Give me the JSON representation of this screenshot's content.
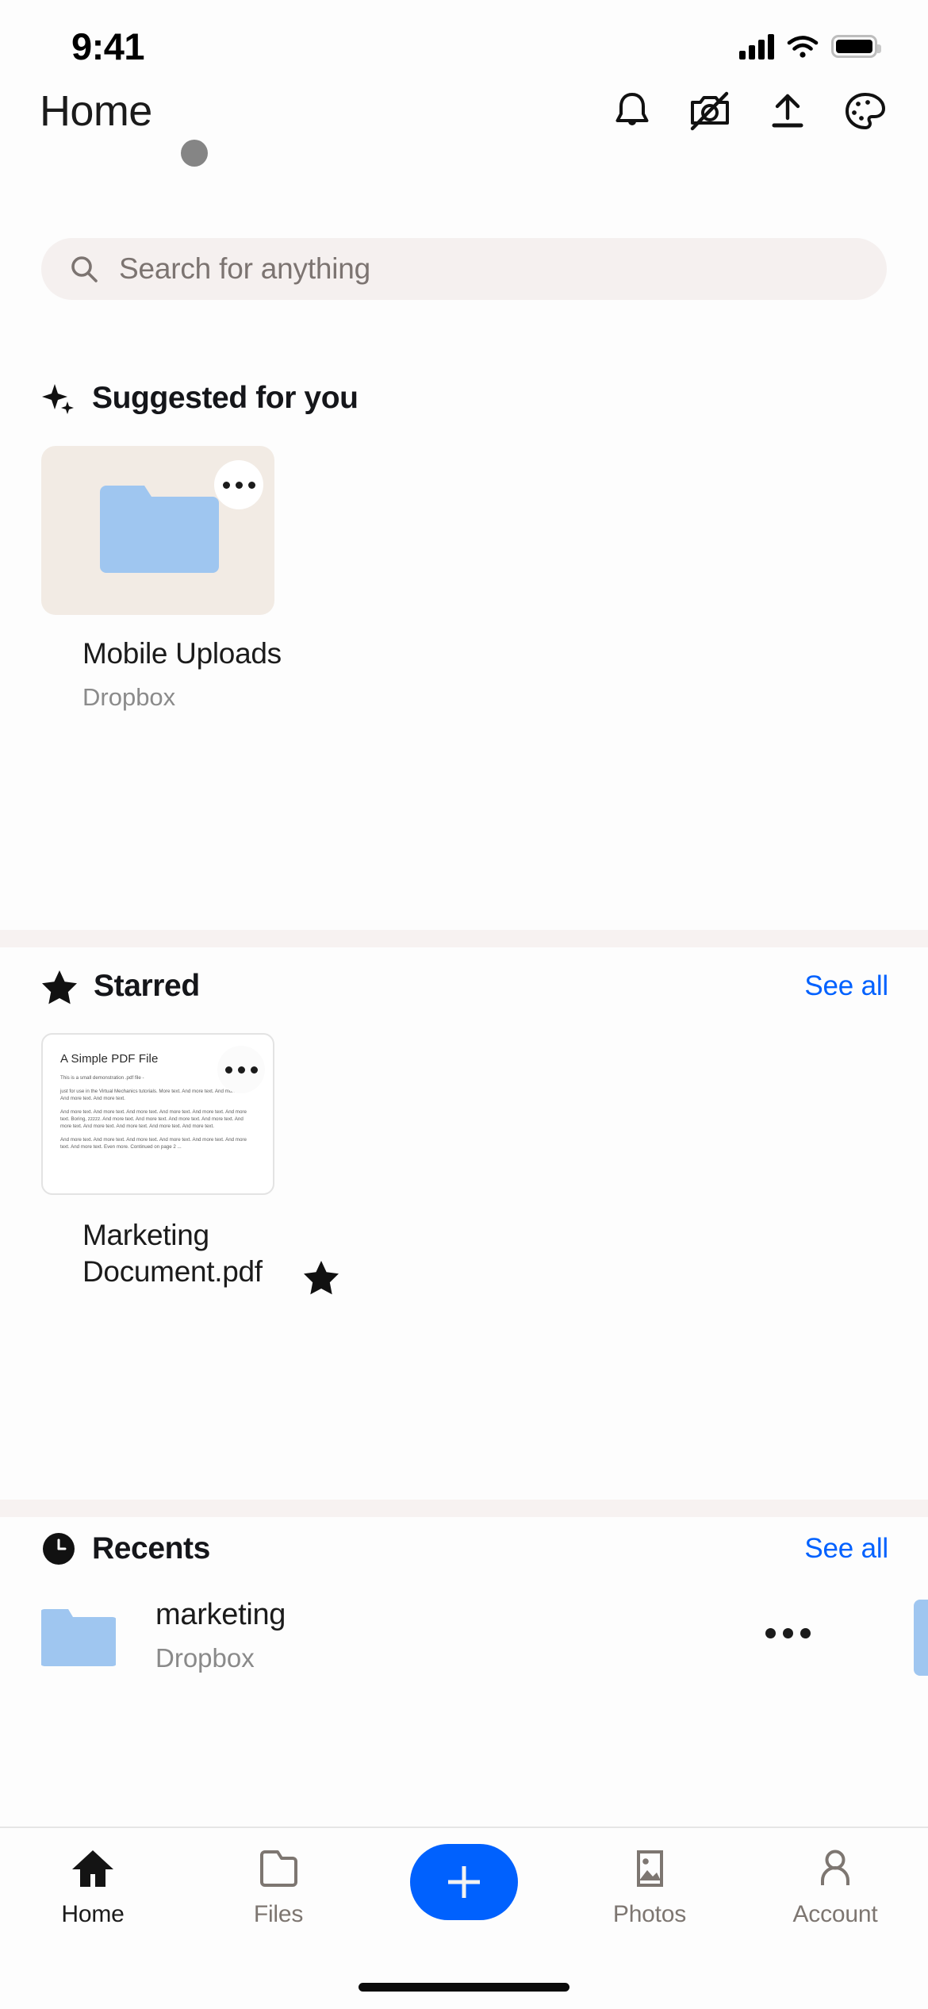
{
  "status_bar": {
    "time": "9:41",
    "cellular_icon": "cellular-signal-icon",
    "wifi_icon": "wifi-icon",
    "battery_icon": "battery-full-icon"
  },
  "header": {
    "title": "Home",
    "actions": [
      {
        "name": "notifications-icon",
        "label": "Notifications"
      },
      {
        "name": "camera-upload-off-icon",
        "label": "Camera upload off"
      },
      {
        "name": "upload-icon",
        "label": "Upload"
      },
      {
        "name": "palette-icon",
        "label": "Theme"
      }
    ]
  },
  "search": {
    "icon": "search-icon",
    "placeholder": "Search for anything",
    "value": ""
  },
  "sections": {
    "suggested": {
      "icon": "sparkle-icon",
      "title": "Suggested for you",
      "card": {
        "thumbnail": "folder-icon",
        "overflow_icon": "more-horizontal-icon",
        "name": "Mobile Uploads",
        "location": "Dropbox",
        "card_bg": "#F2EBE4",
        "folder_color": "#9FC6F0"
      }
    },
    "starred": {
      "icon": "star-filled-icon",
      "title": "Starred",
      "see_all": "See all",
      "card": {
        "thumbnail": "pdf-preview",
        "overflow_icon": "more-horizontal-icon",
        "name": "Marketing Document.pdf",
        "name_line1": "Marketing",
        "name_line2": "Document.pdf",
        "badge_icon": "star-filled-icon",
        "preview": {
          "title": "A Simple PDF File",
          "lines": [
            "This is a small demonstration .pdf file -",
            "just for use in the Virtual Mechanics tutorials. More text. And more text. And more text. And more text. And more text.",
            "And more text. And more text. And more text. And more text. And more text. And more text. Boring, zzzzz. And more text. And more text. And more text. And more text. And more text. And more text. And more text. And more text. And more text.",
            "And more text. And more text. And more text. And more text. And more text. And more text. And more text. Even more. Continued on page 2 ..."
          ]
        }
      }
    },
    "recents": {
      "icon": "clock-icon",
      "title": "Recents",
      "see_all": "See all",
      "items": [
        {
          "thumbnail": "folder-icon",
          "name": "marketing",
          "location": "Dropbox",
          "overflow_icon": "more-horizontal-icon"
        }
      ]
    }
  },
  "tabbar": {
    "items": [
      {
        "icon": "home-icon",
        "label": "Home",
        "active": true
      },
      {
        "icon": "folder-outline-icon",
        "label": "Files",
        "active": false
      },
      {
        "icon": "plus-icon",
        "label": "",
        "active": false,
        "is_fab": true
      },
      {
        "icon": "photos-icon",
        "label": "Photos",
        "active": false
      },
      {
        "icon": "account-icon",
        "label": "Account",
        "active": false
      }
    ]
  },
  "colors": {
    "accent_blue": "#0061FE",
    "link_blue": "#0061FE",
    "folder_blue": "#9FC6F0",
    "card_beige": "#F2EBE4",
    "search_bg": "#F5F0EF",
    "band_bg": "#F7F2F1"
  }
}
